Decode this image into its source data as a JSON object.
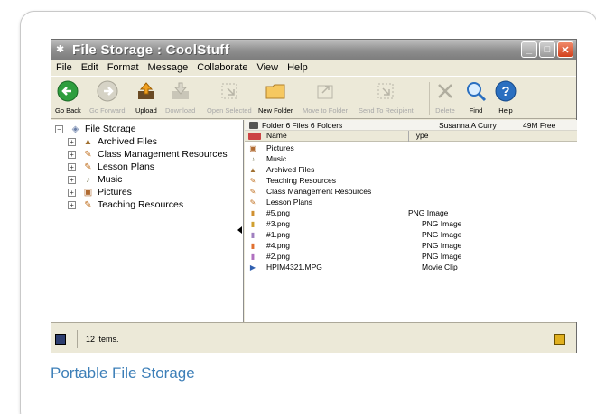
{
  "window": {
    "title": "File Storage : CoolStuff",
    "caption": "Portable File Storage"
  },
  "menu": [
    "File",
    "Edit",
    "Format",
    "Message",
    "Collaborate",
    "View",
    "Help"
  ],
  "toolbar": {
    "go_back": "Go Back",
    "go_forward": "Go Forward",
    "upload": "Upload",
    "download": "Download",
    "open_selected": "Open Selected",
    "new_folder": "New Folder",
    "move_to_folder": "Move to Folder",
    "send_to_recipient": "Send To Recipient",
    "delete": "Delete",
    "find": "Find",
    "help": "Help"
  },
  "tree": {
    "root": "File Storage",
    "children": [
      "Archived Files",
      "Class Management Resources",
      "Lesson Plans",
      "Music",
      "Pictures",
      "Teaching Resources"
    ]
  },
  "list": {
    "folder_info": "Folder   6 Files  6 Folders",
    "user": "Susanna A Curry",
    "free": "49M Free",
    "header_name": "Name",
    "header_type": "Type",
    "rows": [
      {
        "name": "Pictures",
        "type": ""
      },
      {
        "name": "Music",
        "type": ""
      },
      {
        "name": "Archived Files",
        "type": ""
      },
      {
        "name": "Teaching Resources",
        "type": ""
      },
      {
        "name": "Class Management Resources",
        "type": ""
      },
      {
        "name": "Lesson Plans",
        "type": ""
      },
      {
        "name": "#5.png",
        "type": "PNG Image"
      },
      {
        "name": "#3.png",
        "type": "PNG Image"
      },
      {
        "name": "#1.png",
        "type": "PNG Image"
      },
      {
        "name": "#4.png",
        "type": "PNG Image"
      },
      {
        "name": "#2.png",
        "type": "PNG Image"
      },
      {
        "name": "HPIM4321.MPG",
        "type": "Movie Clip"
      }
    ]
  },
  "status": {
    "items": "12 items."
  }
}
